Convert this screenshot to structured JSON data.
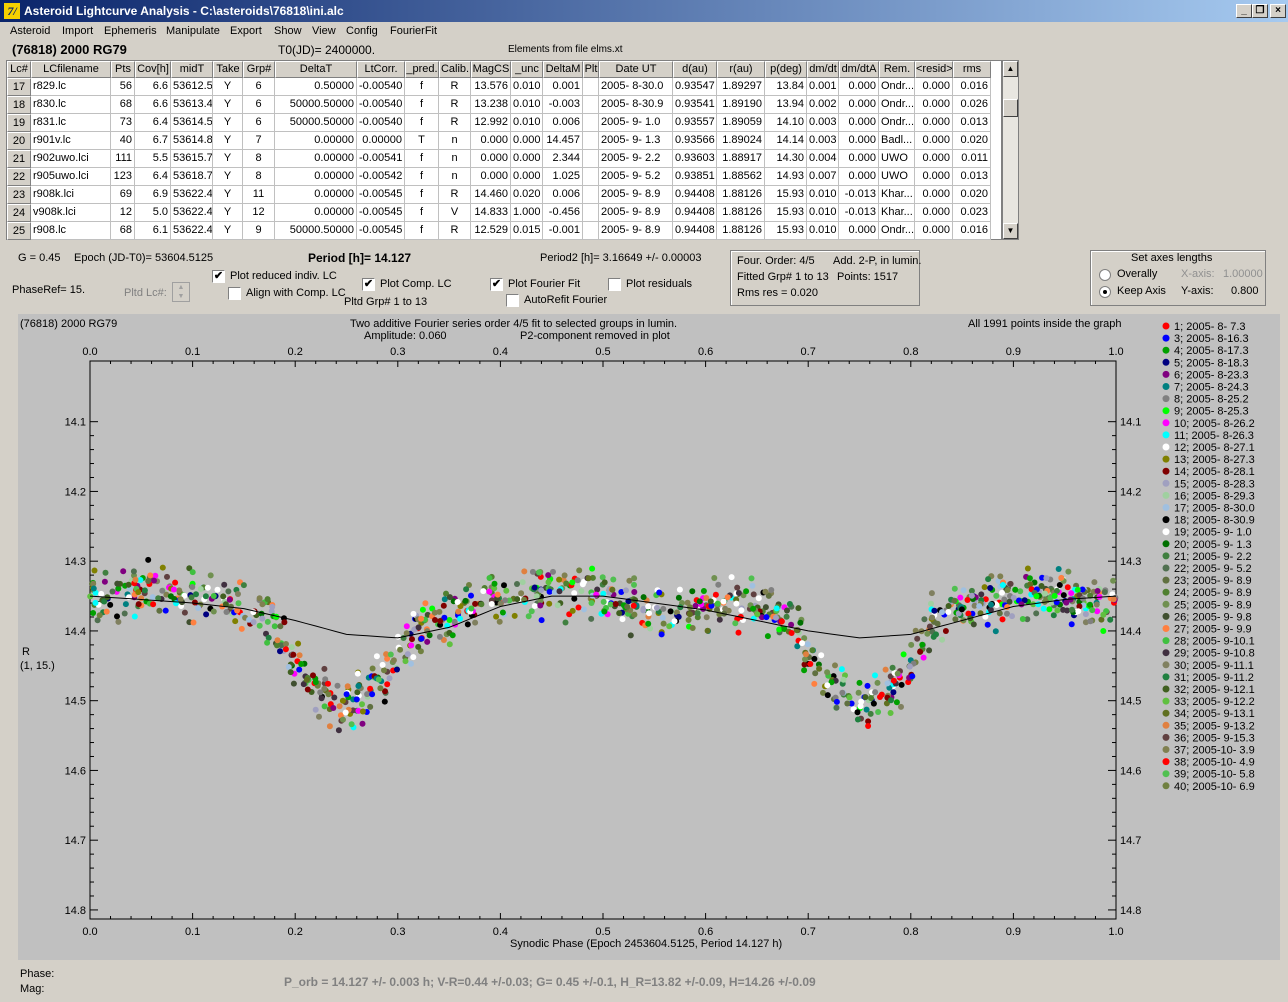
{
  "window": {
    "title": "Asteroid Lightcurve Analysis - C:\\asteroids\\76818\\ini.alc",
    "icon_letter": "7/",
    "controls": [
      "_",
      "❐",
      "×"
    ]
  },
  "menu": [
    "Asteroid",
    "Import",
    "Ephemeris",
    "Manipulate",
    "Export",
    "Show",
    "View",
    "Config",
    "FourierFit"
  ],
  "header": {
    "object": "(76818) 2000 RG79",
    "t0": "T0(JD)= 2400000.",
    "elements": "Elements from file elms.xt"
  },
  "table": {
    "columns": [
      "Lc#",
      "LCfilename",
      "Pts",
      "Cov[h]",
      "midT",
      "Take",
      "Grp#",
      "DeltaT",
      "LtCorr.",
      "_pred.",
      "Calib.",
      "MagCS",
      "_unc",
      "DeltaM",
      "Plt",
      "Date UT",
      "d(au)",
      "r(au)",
      "p(deg)",
      "dm/dt",
      "dm/dtA",
      "Rem.",
      "<resid>",
      "rms res"
    ],
    "rows": [
      [
        "17",
        "r829.lc",
        "56",
        "6.6",
        "53612.5",
        "Y",
        "6",
        "0.50000",
        "-0.00540",
        "f",
        "R",
        "13.576",
        "0.010",
        "0.001",
        "",
        "2005- 8-30.0",
        "0.93547",
        "1.89297",
        "13.84",
        "0.001",
        "0.000",
        "Ondr...",
        "0.000",
        "0.016"
      ],
      [
        "18",
        "r830.lc",
        "68",
        "6.6",
        "53613.4",
        "Y",
        "6",
        "50000.50000",
        "-0.00540",
        "f",
        "R",
        "13.238",
        "0.010",
        "-0.003",
        "",
        "2005- 8-30.9",
        "0.93541",
        "1.89190",
        "13.94",
        "0.002",
        "0.000",
        "Ondr...",
        "0.000",
        "0.026"
      ],
      [
        "19",
        "r831.lc",
        "73",
        "6.4",
        "53614.5",
        "Y",
        "6",
        "50000.50000",
        "-0.00540",
        "f",
        "R",
        "12.992",
        "0.010",
        "0.006",
        "",
        "2005- 9- 1.0",
        "0.93557",
        "1.89059",
        "14.10",
        "0.003",
        "0.000",
        "Ondr...",
        "0.000",
        "0.013"
      ],
      [
        "20",
        "r901v.lc",
        "40",
        "6.7",
        "53614.8",
        "Y",
        "7",
        "0.00000",
        "0.00000",
        "T",
        "n",
        "0.000",
        "0.000",
        "14.457",
        "",
        "2005- 9- 1.3",
        "0.93566",
        "1.89024",
        "14.14",
        "0.003",
        "0.000",
        "Badl...",
        "0.000",
        "0.020"
      ],
      [
        "21",
        "r902uwo.lci",
        "111",
        "5.5",
        "53615.7",
        "Y",
        "8",
        "0.00000",
        "-0.00541",
        "f",
        "n",
        "0.000",
        "0.000",
        "2.344",
        "",
        "2005- 9- 2.2",
        "0.93603",
        "1.88917",
        "14.30",
        "0.004",
        "0.000",
        "UWO",
        "0.000",
        "0.011"
      ],
      [
        "22",
        "r905uwo.lci",
        "123",
        "6.4",
        "53618.7",
        "Y",
        "8",
        "0.00000",
        "-0.00542",
        "f",
        "n",
        "0.000",
        "0.000",
        "1.025",
        "",
        "2005- 9- 5.2",
        "0.93851",
        "1.88562",
        "14.93",
        "0.007",
        "0.000",
        "UWO",
        "0.000",
        "0.013"
      ],
      [
        "23",
        "r908k.lci",
        "69",
        "6.9",
        "53622.4",
        "Y",
        "11",
        "0.00000",
        "-0.00545",
        "f",
        "R",
        "14.460",
        "0.020",
        "0.006",
        "",
        "2005- 9- 8.9",
        "0.94408",
        "1.88126",
        "15.93",
        "0.010",
        "-0.013",
        "Khar...",
        "0.000",
        "0.020"
      ],
      [
        "24",
        "v908k.lci",
        "12",
        "5.0",
        "53622.4",
        "Y",
        "12",
        "0.00000",
        "-0.00545",
        "f",
        "V",
        "14.833",
        "1.000",
        "-0.456",
        "",
        "2005- 9- 8.9",
        "0.94408",
        "1.88126",
        "15.93",
        "0.010",
        "-0.013",
        "Khar...",
        "0.000",
        "0.023"
      ],
      [
        "25",
        "r908.lc",
        "68",
        "6.1",
        "53622.4",
        "Y",
        "9",
        "50000.50000",
        "-0.00545",
        "f",
        "R",
        "12.529",
        "0.015",
        "-0.001",
        "",
        "2005- 9- 8.9",
        "0.94408",
        "1.88126",
        "15.93",
        "0.010",
        "0.000",
        "Ondr...",
        "0.000",
        "0.016"
      ]
    ]
  },
  "controls": {
    "g_label": "G = 0.45",
    "epoch_label": "Epoch (JD-T0)= 53604.5125",
    "period_label": "Period [h]= 14.127",
    "period2_label": "Period2 [h]= 3.16649 +/- 0.00003",
    "phaseref_label": "PhaseRef= 15.",
    "pltd_lc_label": "Pltd Lc#:",
    "plot_reduced": "Plot reduced indiv. LC",
    "align_comp": "Align with Comp. LC",
    "plot_comp": "Plot Comp. LC",
    "pltd_grp": "Pltd Grp#  1  to  13",
    "plot_fourier": "Plot Fourier Fit",
    "autorefit": "AutoRefit Fourier",
    "plot_residuals": "Plot residuals",
    "checked": {
      "plot_reduced": true,
      "align_comp": false,
      "plot_comp": true,
      "plot_fourier": true,
      "autorefit": false,
      "plot_residuals": false
    }
  },
  "fourier_box": {
    "order": "Four. Order:  4/5",
    "add": "Add. 2-P, in lumin.",
    "fitted": "Fitted Grp# 1 to 13",
    "points": "Points: 1517",
    "rms": "Rms res     = 0.020"
  },
  "axes_box": {
    "title": "Set axes lengths",
    "overally": "Overally",
    "keep_axis": "Keep Axis",
    "x_axis_label": "X-axis:",
    "x_axis_value": "1.00000",
    "y_axis_label": "Y-axis:",
    "y_axis_value": "0.800",
    "selected": "keep_axis"
  },
  "plot": {
    "object": "(76818) 2000 RG79",
    "subtitle1": "Two additive Fourier series order 4/5 fit to selected groups in lumin.",
    "subtitle2": "Amplitude: 0.060",
    "subtitle3": "P2-component removed in plot",
    "points_note": "All 1991 points inside the graph",
    "y_label_line1": "R",
    "y_label_line2": "(1, 15.)",
    "x_label": "Synodic Phase (Epoch 2453604.5125, Period 14.127 h)",
    "x_ticks": [
      "0.0",
      "0.1",
      "0.2",
      "0.3",
      "0.4",
      "0.5",
      "0.6",
      "0.7",
      "0.8",
      "0.9",
      "1.0"
    ],
    "y_ticks": [
      "14.1",
      "14.2",
      "14.3",
      "14.4",
      "14.5",
      "14.6",
      "14.7",
      "14.8"
    ]
  },
  "chart_data": {
    "type": "scatter",
    "xlabel": "Synodic Phase (Epoch 2453604.5125, Period 14.127 h)",
    "ylabel": "R",
    "xlim": [
      0.0,
      1.0
    ],
    "ylim": [
      14.013,
      14.813
    ],
    "y_inverted": true,
    "fourier_curve": {
      "x": [
        0.0,
        0.05,
        0.1,
        0.15,
        0.2,
        0.25,
        0.3,
        0.35,
        0.4,
        0.45,
        0.5,
        0.55,
        0.6,
        0.65,
        0.7,
        0.75,
        0.8,
        0.85,
        0.9,
        0.95,
        1.0
      ],
      "y": [
        14.35,
        14.355,
        14.36,
        14.368,
        14.385,
        14.405,
        14.41,
        14.395,
        14.365,
        14.35,
        14.35,
        14.36,
        14.37,
        14.385,
        14.4,
        14.41,
        14.405,
        14.385,
        14.365,
        14.355,
        14.35
      ]
    },
    "lightcurve_shape": {
      "x": [
        0.0,
        0.05,
        0.1,
        0.15,
        0.18,
        0.2,
        0.22,
        0.25,
        0.27,
        0.3,
        0.33,
        0.36,
        0.4,
        0.45,
        0.5,
        0.55,
        0.6,
        0.65,
        0.68,
        0.7,
        0.72,
        0.75,
        0.78,
        0.8,
        0.82,
        0.85,
        0.9,
        0.95,
        1.0
      ],
      "y": [
        14.35,
        14.34,
        14.35,
        14.36,
        14.39,
        14.44,
        14.49,
        14.51,
        14.49,
        14.43,
        14.39,
        14.37,
        14.35,
        14.34,
        14.35,
        14.37,
        14.37,
        14.36,
        14.38,
        14.43,
        14.48,
        14.51,
        14.49,
        14.45,
        14.39,
        14.37,
        14.35,
        14.35,
        14.36
      ]
    },
    "series": [
      {
        "name": "1; 2005- 8- 7.3",
        "color": "#ff0000"
      },
      {
        "name": "3; 2005- 8-16.3",
        "color": "#0000ff"
      },
      {
        "name": "4; 2005- 8-17.3",
        "color": "#00a000"
      },
      {
        "name": "5; 2005- 8-18.3",
        "color": "#000080"
      },
      {
        "name": "6; 2005- 8-23.3",
        "color": "#800080"
      },
      {
        "name": "7; 2005- 8-24.3",
        "color": "#008080"
      },
      {
        "name": "8; 2005- 8-25.2",
        "color": "#808080"
      },
      {
        "name": "9; 2005- 8-25.3",
        "color": "#00ff00"
      },
      {
        "name": "10; 2005- 8-26.2",
        "color": "#ff00ff"
      },
      {
        "name": "11; 2005- 8-26.3",
        "color": "#00ffff"
      },
      {
        "name": "12; 2005- 8-27.1",
        "color": "#ffffff"
      },
      {
        "name": "13; 2005- 8-27.3",
        "color": "#808000"
      },
      {
        "name": "14; 2005- 8-28.1",
        "color": "#800000"
      },
      {
        "name": "15; 2005- 8-28.3",
        "color": "#a0a0c0"
      },
      {
        "name": "16; 2005- 8-29.3",
        "color": "#a0d0a0"
      },
      {
        "name": "17; 2005- 8-30.0",
        "color": "#a0c0e0"
      },
      {
        "name": "18; 2005- 8-30.9",
        "color": "#000000"
      },
      {
        "name": "19; 2005- 9- 1.0",
        "color": "#ffffff"
      },
      {
        "name": "20; 2005- 9- 1.3",
        "color": "#007000"
      },
      {
        "name": "21; 2005- 9- 2.2",
        "color": "#408040"
      },
      {
        "name": "22; 2005- 9- 5.2",
        "color": "#507050"
      },
      {
        "name": "23; 2005- 9- 8.9",
        "color": "#607040"
      },
      {
        "name": "24; 2005- 9- 8.9",
        "color": "#508030"
      },
      {
        "name": "25; 2005- 9- 8.9",
        "color": "#709050"
      },
      {
        "name": "26; 2005- 9- 9.8",
        "color": "#405030"
      },
      {
        "name": "27; 2005- 9- 9.9",
        "color": "#ff8040"
      },
      {
        "name": "28; 2005- 9-10.1",
        "color": "#40c040"
      },
      {
        "name": "29; 2005- 9-10.8",
        "color": "#403040"
      },
      {
        "name": "30; 2005- 9-11.1",
        "color": "#808060"
      },
      {
        "name": "31; 2005- 9-11.2",
        "color": "#208040"
      },
      {
        "name": "32; 2005- 9-12.1",
        "color": "#406020"
      },
      {
        "name": "33; 2005- 9-12.2",
        "color": "#60c040"
      },
      {
        "name": "34; 2005- 9-13.1",
        "color": "#607020"
      },
      {
        "name": "35; 2005- 9-13.2",
        "color": "#e08040"
      },
      {
        "name": "36; 2005- 9-15.3",
        "color": "#604040"
      },
      {
        "name": "37; 2005-10- 3.9",
        "color": "#808050"
      },
      {
        "name": "38; 2005-10- 4.9",
        "color": "#ff0000"
      },
      {
        "name": "39; 2005-10- 5.8",
        "color": "#50c050"
      },
      {
        "name": "40; 2005-10- 6.9",
        "color": "#708040"
      }
    ]
  },
  "status": {
    "phase_label": "Phase:",
    "mag_label": "Mag:",
    "result": "P_orb = 14.127 +/- 0.003 h; V-R=0.44 +/-0.03; G= 0.45 +/-0.1, H_R=13.82 +/-0.09, H=14.26 +/-0.09"
  }
}
